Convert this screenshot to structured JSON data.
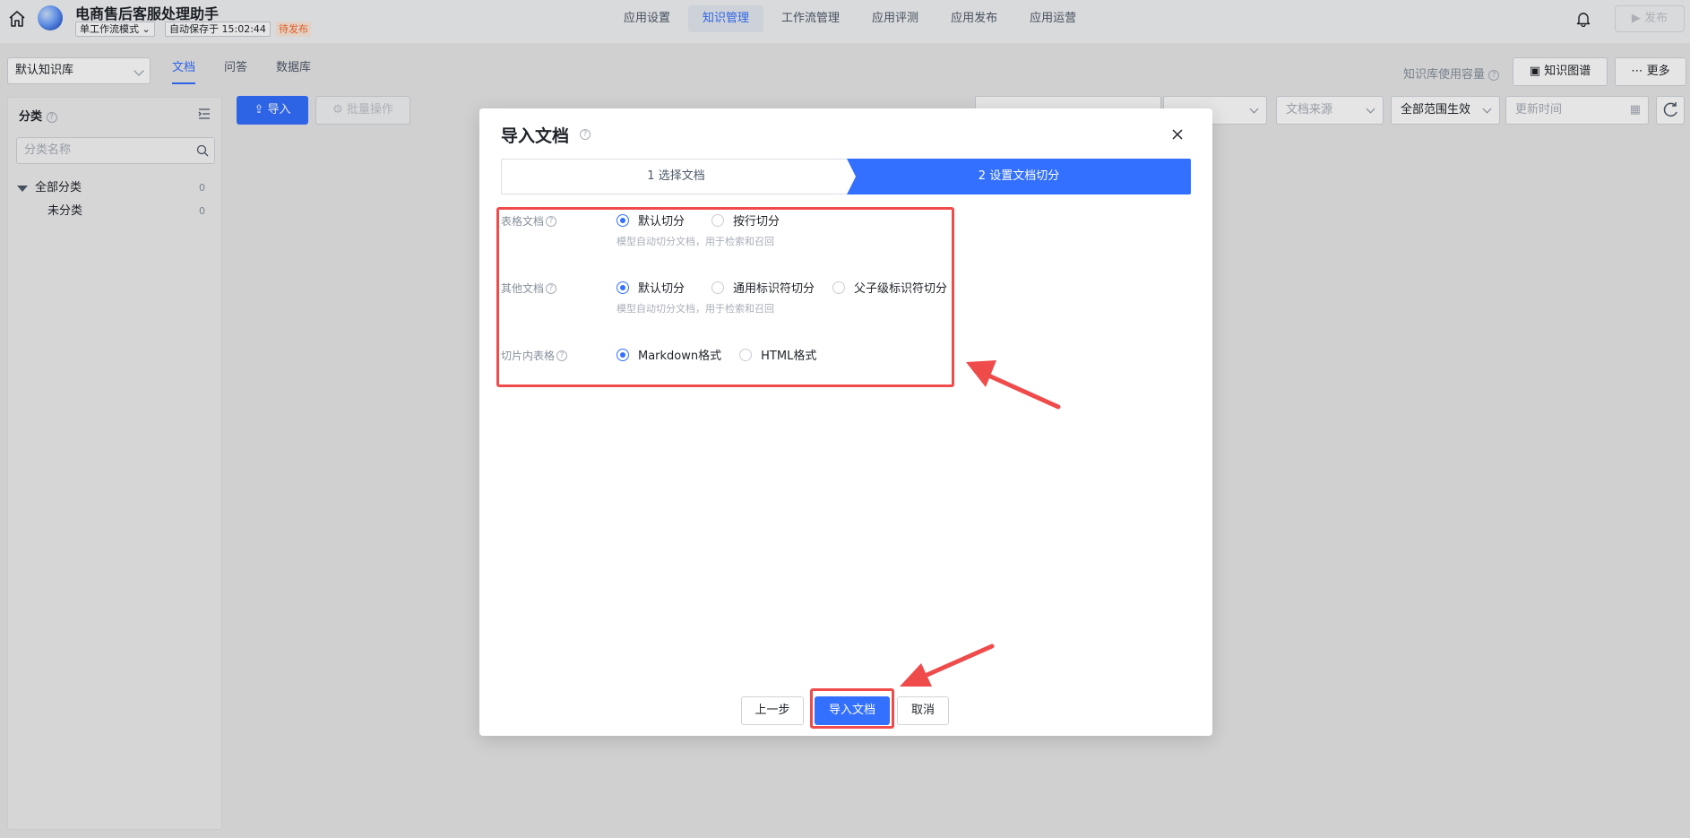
{
  "app": {
    "title": "电商售后客服处理助手",
    "mode": "单工作流模式",
    "autosave": "自动保存于 15:02:44",
    "status": "待发布",
    "publish_label": "发布"
  },
  "nav": {
    "tabs": [
      {
        "label": "应用设置"
      },
      {
        "label": "知识管理"
      },
      {
        "label": "工作流管理"
      },
      {
        "label": "应用评测"
      },
      {
        "label": "应用发布"
      },
      {
        "label": "应用运营"
      }
    ],
    "active_index": 1
  },
  "kb": {
    "selected": "默认知识库",
    "subtabs": [
      "文档",
      "问答",
      "数据库"
    ],
    "capacity_label": "知识库使用容量",
    "graph_label": "知识图谱",
    "more_label": "更多"
  },
  "sidebar": {
    "title": "分类",
    "search_placeholder": "分类名称",
    "tree": [
      {
        "label": "全部分类",
        "count": "0"
      },
      {
        "label": "未分类",
        "count": "0"
      }
    ]
  },
  "toolbar": {
    "import_label": "导入",
    "batch_label": "批量操作",
    "source_placeholder": "文档来源",
    "scope_value": "全部范围生效",
    "time_placeholder": "更新时间"
  },
  "modal": {
    "title": "导入文档",
    "steps": [
      "1 选择文档",
      "2 设置文档切分"
    ],
    "sections": {
      "table_doc": {
        "label": "表格文档",
        "options": [
          "默认切分",
          "按行切分"
        ],
        "hint": "模型自动切分文档，用于检索和召回"
      },
      "other_doc": {
        "label": "其他文档",
        "options": [
          "默认切分",
          "通用标识符切分",
          "父子级标识符切分"
        ],
        "hint": "模型自动切分文档，用于检索和召回"
      },
      "slice_table": {
        "label": "切片内表格",
        "options": [
          "Markdown格式",
          "HTML格式"
        ]
      }
    },
    "footer": {
      "prev_label": "上一步",
      "import_label": "导入文档",
      "cancel_label": "取消"
    }
  },
  "colors": {
    "primary": "#3370ff",
    "annotation": "#ef4b4b",
    "pending": "#f76a2a"
  }
}
